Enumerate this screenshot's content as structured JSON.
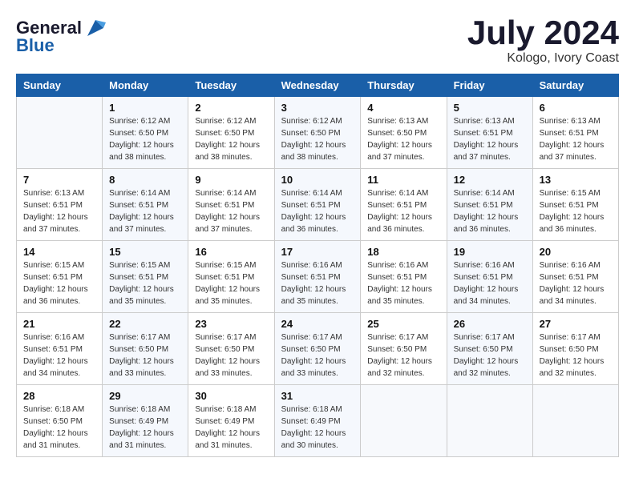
{
  "header": {
    "logo_line1": "General",
    "logo_line2": "Blue",
    "month_title": "July 2024",
    "location": "Kologo, Ivory Coast"
  },
  "calendar": {
    "weekdays": [
      "Sunday",
      "Monday",
      "Tuesday",
      "Wednesday",
      "Thursday",
      "Friday",
      "Saturday"
    ],
    "weeks": [
      [
        {
          "day": "",
          "info": ""
        },
        {
          "day": "1",
          "info": "Sunrise: 6:12 AM\nSunset: 6:50 PM\nDaylight: 12 hours\nand 38 minutes."
        },
        {
          "day": "2",
          "info": "Sunrise: 6:12 AM\nSunset: 6:50 PM\nDaylight: 12 hours\nand 38 minutes."
        },
        {
          "day": "3",
          "info": "Sunrise: 6:12 AM\nSunset: 6:50 PM\nDaylight: 12 hours\nand 38 minutes."
        },
        {
          "day": "4",
          "info": "Sunrise: 6:13 AM\nSunset: 6:50 PM\nDaylight: 12 hours\nand 37 minutes."
        },
        {
          "day": "5",
          "info": "Sunrise: 6:13 AM\nSunset: 6:51 PM\nDaylight: 12 hours\nand 37 minutes."
        },
        {
          "day": "6",
          "info": "Sunrise: 6:13 AM\nSunset: 6:51 PM\nDaylight: 12 hours\nand 37 minutes."
        }
      ],
      [
        {
          "day": "7",
          "info": "Sunrise: 6:13 AM\nSunset: 6:51 PM\nDaylight: 12 hours\nand 37 minutes."
        },
        {
          "day": "8",
          "info": "Sunrise: 6:14 AM\nSunset: 6:51 PM\nDaylight: 12 hours\nand 37 minutes."
        },
        {
          "day": "9",
          "info": "Sunrise: 6:14 AM\nSunset: 6:51 PM\nDaylight: 12 hours\nand 37 minutes."
        },
        {
          "day": "10",
          "info": "Sunrise: 6:14 AM\nSunset: 6:51 PM\nDaylight: 12 hours\nand 36 minutes."
        },
        {
          "day": "11",
          "info": "Sunrise: 6:14 AM\nSunset: 6:51 PM\nDaylight: 12 hours\nand 36 minutes."
        },
        {
          "day": "12",
          "info": "Sunrise: 6:14 AM\nSunset: 6:51 PM\nDaylight: 12 hours\nand 36 minutes."
        },
        {
          "day": "13",
          "info": "Sunrise: 6:15 AM\nSunset: 6:51 PM\nDaylight: 12 hours\nand 36 minutes."
        }
      ],
      [
        {
          "day": "14",
          "info": "Sunrise: 6:15 AM\nSunset: 6:51 PM\nDaylight: 12 hours\nand 36 minutes."
        },
        {
          "day": "15",
          "info": "Sunrise: 6:15 AM\nSunset: 6:51 PM\nDaylight: 12 hours\nand 35 minutes."
        },
        {
          "day": "16",
          "info": "Sunrise: 6:15 AM\nSunset: 6:51 PM\nDaylight: 12 hours\nand 35 minutes."
        },
        {
          "day": "17",
          "info": "Sunrise: 6:16 AM\nSunset: 6:51 PM\nDaylight: 12 hours\nand 35 minutes."
        },
        {
          "day": "18",
          "info": "Sunrise: 6:16 AM\nSunset: 6:51 PM\nDaylight: 12 hours\nand 35 minutes."
        },
        {
          "day": "19",
          "info": "Sunrise: 6:16 AM\nSunset: 6:51 PM\nDaylight: 12 hours\nand 34 minutes."
        },
        {
          "day": "20",
          "info": "Sunrise: 6:16 AM\nSunset: 6:51 PM\nDaylight: 12 hours\nand 34 minutes."
        }
      ],
      [
        {
          "day": "21",
          "info": "Sunrise: 6:16 AM\nSunset: 6:51 PM\nDaylight: 12 hours\nand 34 minutes."
        },
        {
          "day": "22",
          "info": "Sunrise: 6:17 AM\nSunset: 6:50 PM\nDaylight: 12 hours\nand 33 minutes."
        },
        {
          "day": "23",
          "info": "Sunrise: 6:17 AM\nSunset: 6:50 PM\nDaylight: 12 hours\nand 33 minutes."
        },
        {
          "day": "24",
          "info": "Sunrise: 6:17 AM\nSunset: 6:50 PM\nDaylight: 12 hours\nand 33 minutes."
        },
        {
          "day": "25",
          "info": "Sunrise: 6:17 AM\nSunset: 6:50 PM\nDaylight: 12 hours\nand 32 minutes."
        },
        {
          "day": "26",
          "info": "Sunrise: 6:17 AM\nSunset: 6:50 PM\nDaylight: 12 hours\nand 32 minutes."
        },
        {
          "day": "27",
          "info": "Sunrise: 6:17 AM\nSunset: 6:50 PM\nDaylight: 12 hours\nand 32 minutes."
        }
      ],
      [
        {
          "day": "28",
          "info": "Sunrise: 6:18 AM\nSunset: 6:50 PM\nDaylight: 12 hours\nand 31 minutes."
        },
        {
          "day": "29",
          "info": "Sunrise: 6:18 AM\nSunset: 6:49 PM\nDaylight: 12 hours\nand 31 minutes."
        },
        {
          "day": "30",
          "info": "Sunrise: 6:18 AM\nSunset: 6:49 PM\nDaylight: 12 hours\nand 31 minutes."
        },
        {
          "day": "31",
          "info": "Sunrise: 6:18 AM\nSunset: 6:49 PM\nDaylight: 12 hours\nand 30 minutes."
        },
        {
          "day": "",
          "info": ""
        },
        {
          "day": "",
          "info": ""
        },
        {
          "day": "",
          "info": ""
        }
      ]
    ]
  }
}
